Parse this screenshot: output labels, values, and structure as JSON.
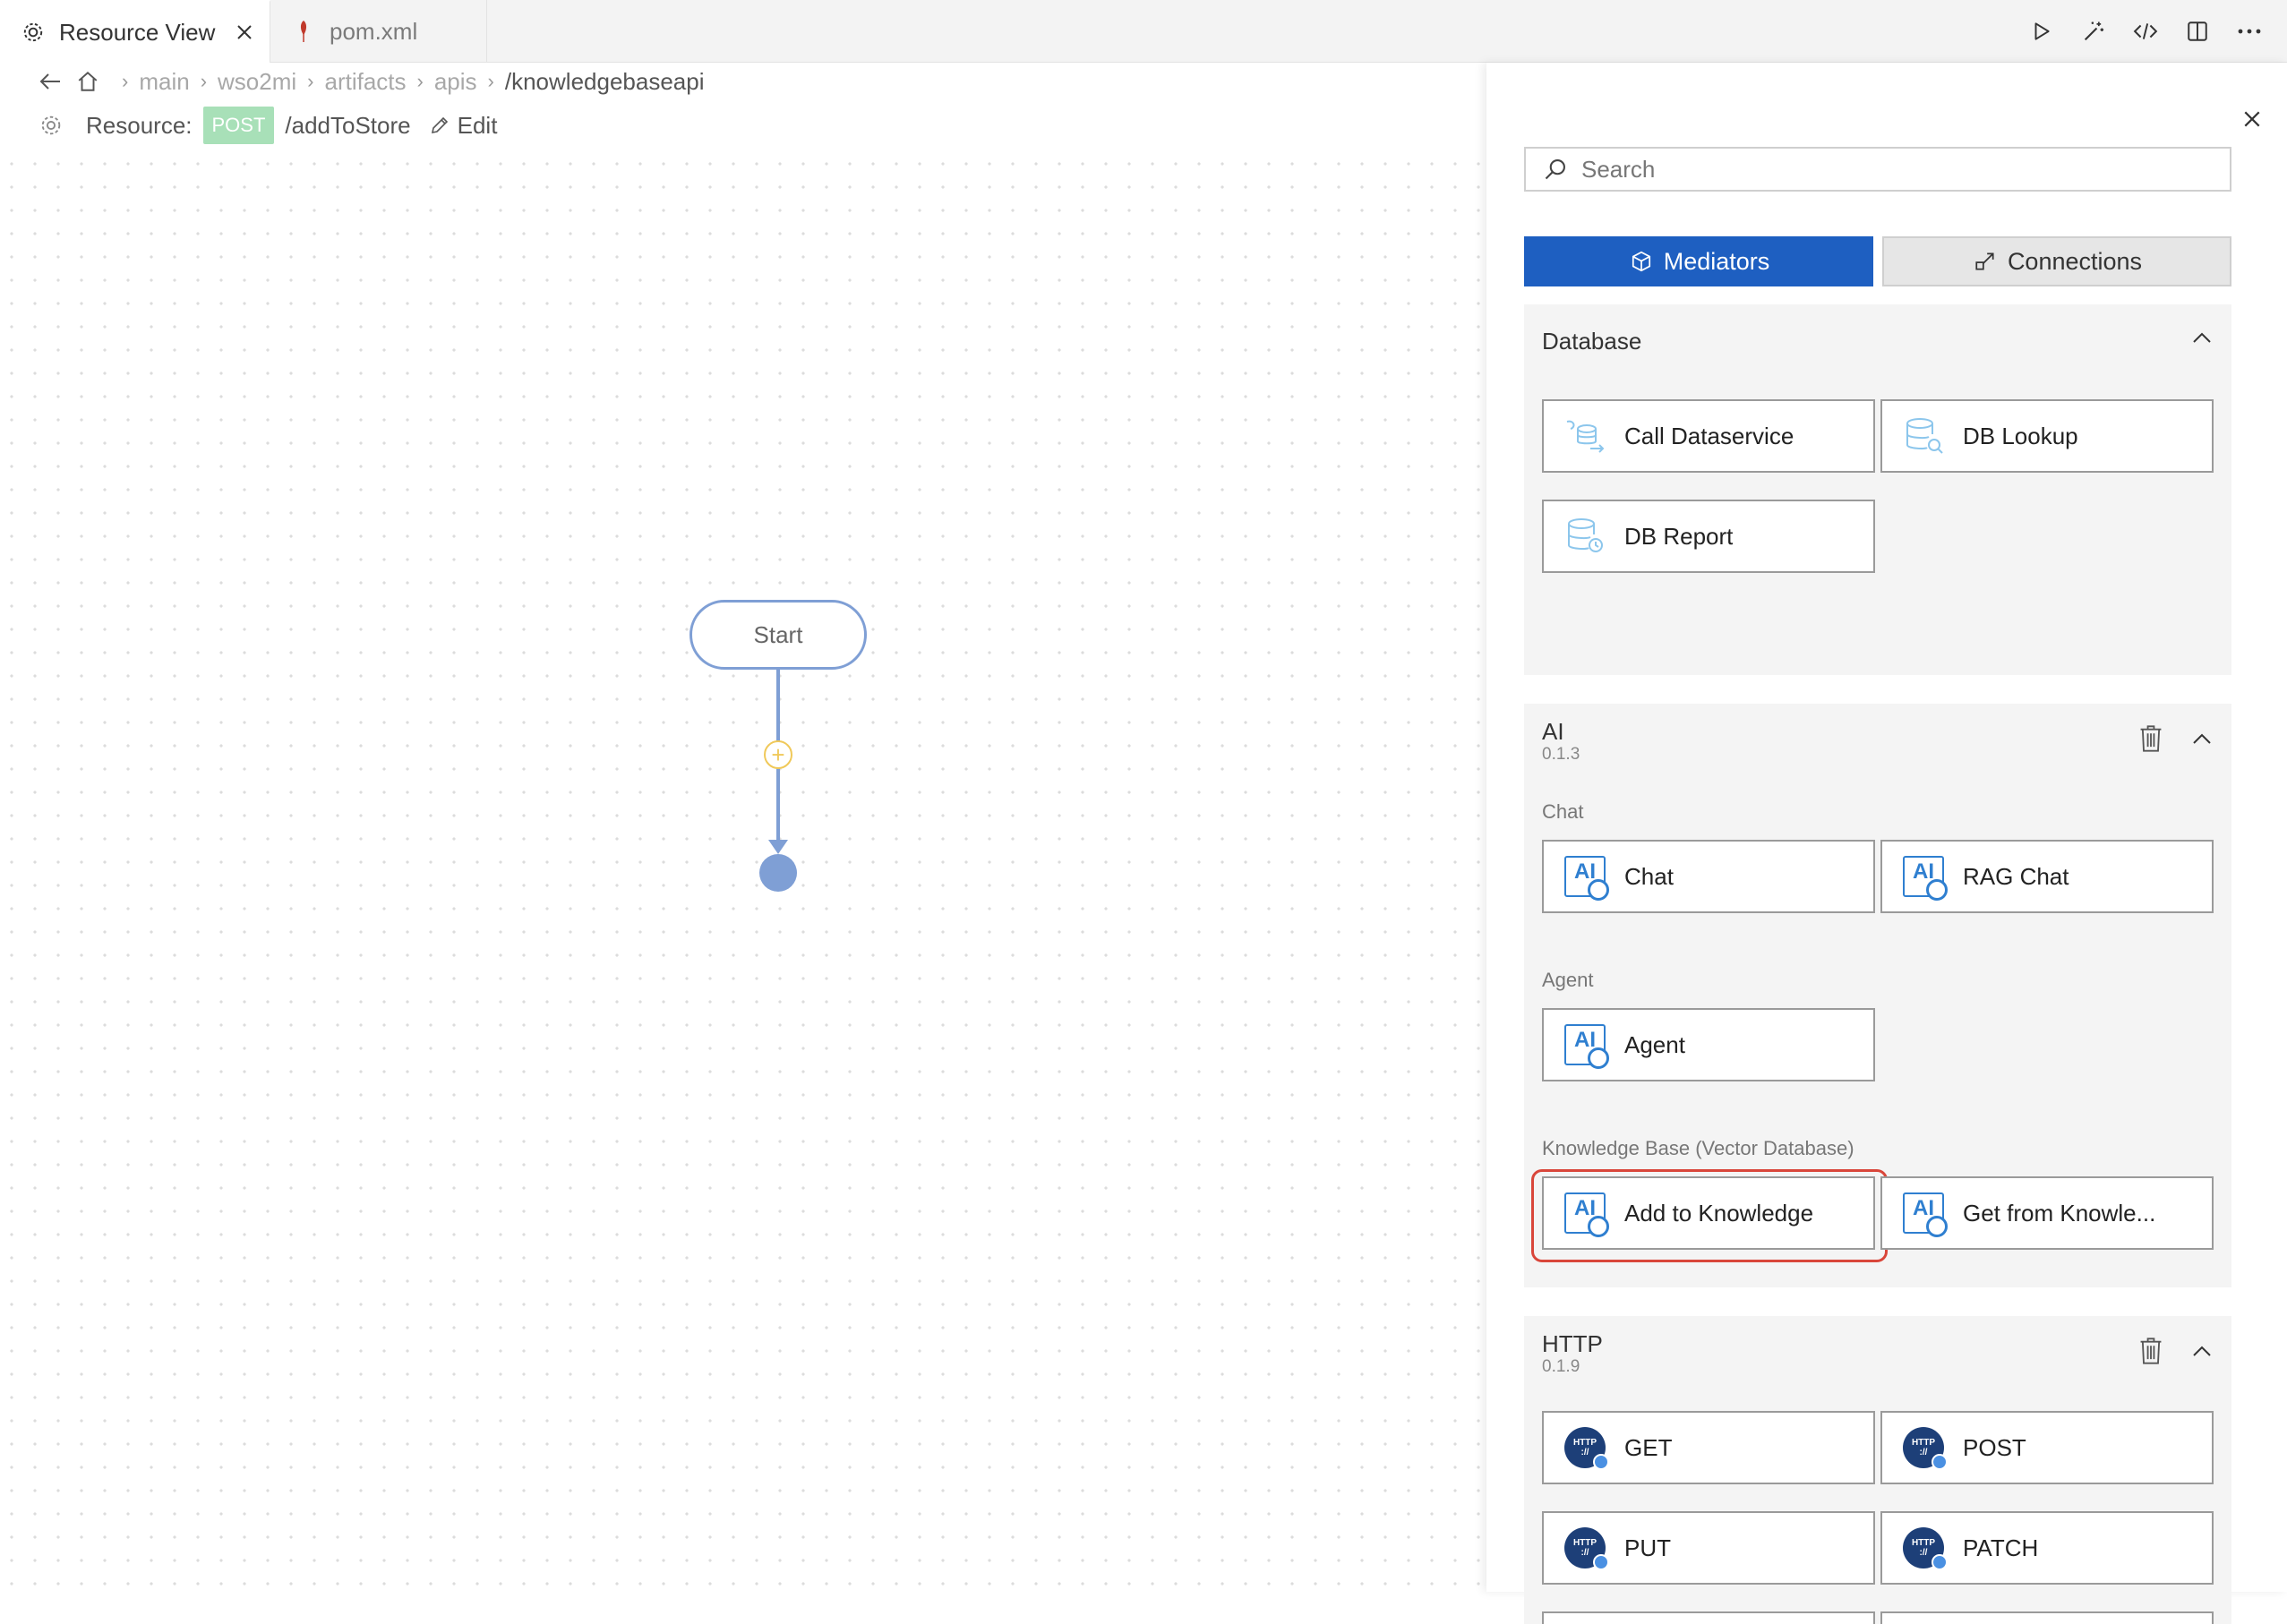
{
  "tabs": [
    {
      "label": "Resource View",
      "active": true,
      "icon": "gear-icon"
    },
    {
      "label": "pom.xml",
      "active": false,
      "icon": "maven-feather-icon"
    }
  ],
  "toolbar": {
    "icons": [
      "run-icon",
      "magic-wand-icon",
      "code-icon",
      "split-editor-icon",
      "more-icon"
    ]
  },
  "breadcrumb": {
    "items": [
      "main",
      "wso2mi",
      "artifacts",
      "apis"
    ],
    "current": "/knowledgebaseapi"
  },
  "resource": {
    "label": "Resource:",
    "method": "POST",
    "path": "/addToStore",
    "edit_label": "Edit",
    "method_color": "#a8e0b8"
  },
  "diagram": {
    "start_label": "Start"
  },
  "panel": {
    "search_placeholder": "Search",
    "tabs": {
      "mediators": "Mediators",
      "connections": "Connections",
      "active": "Mediators"
    },
    "groups": {
      "database": {
        "title": "Database",
        "items": [
          "Call Dataservice",
          "DB Lookup",
          "DB Report"
        ]
      },
      "ai": {
        "title": "AI",
        "version": "0.1.3",
        "subsections": {
          "chat": {
            "label": "Chat",
            "items": [
              "Chat",
              "RAG Chat"
            ]
          },
          "agent": {
            "label": "Agent",
            "items": [
              "Agent"
            ]
          },
          "kb": {
            "label": "Knowledge Base (Vector Database)",
            "items": [
              "Add to Knowledge",
              "Get from Knowle..."
            ]
          }
        }
      },
      "http": {
        "title": "HTTP",
        "version": "0.1.9",
        "items": [
          "GET",
          "POST",
          "PUT",
          "PATCH"
        ],
        "icon_text": "HTTP",
        "icon_sub": "://"
      }
    }
  },
  "colors": {
    "accent": "#1e5fc1",
    "highlight": "#d9463a",
    "flow": "#7f9fd5",
    "plus": "#f0c95a"
  }
}
